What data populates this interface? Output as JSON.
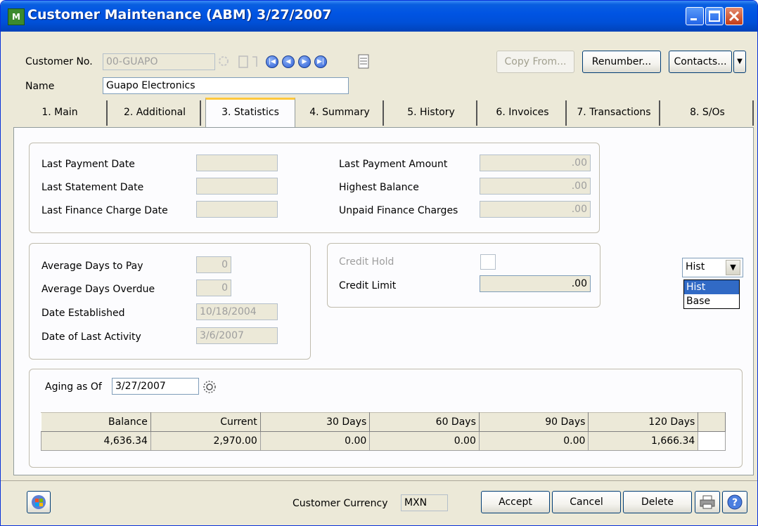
{
  "window": {
    "title": "Customer Maintenance (ABM) 3/27/2007",
    "icon": "app-icon"
  },
  "header": {
    "customer_no_label": "Customer No.",
    "customer_no": "00-GUAPO",
    "name_label": "Name",
    "name": "Guapo Electronics",
    "copy_from": "Copy From...",
    "renumber": "Renumber...",
    "contacts": "Contacts..."
  },
  "tabs": [
    {
      "label": "1. Main"
    },
    {
      "label": "2. Additional"
    },
    {
      "label": "3. Statistics"
    },
    {
      "label": "4. Summary"
    },
    {
      "label": "5. History"
    },
    {
      "label": "6. Invoices"
    },
    {
      "label": "7. Transactions"
    },
    {
      "label": "8. S/Os"
    }
  ],
  "payments": {
    "last_payment_date_label": "Last Payment Date",
    "last_statement_date_label": "Last Statement Date",
    "last_finance_charge_date_label": "Last Finance Charge Date",
    "last_payment_amount_label": "Last Payment Amount",
    "last_payment_amount": ".00",
    "highest_balance_label": "Highest Balance",
    "highest_balance": ".00",
    "unpaid_finance_label": "Unpaid Finance Charges",
    "unpaid_finance": ".00"
  },
  "days": {
    "avg_days_pay_label": "Average Days to Pay",
    "avg_days_pay": "0",
    "avg_days_overdue_label": "Average Days Overdue",
    "avg_days_overdue": "0",
    "date_established_label": "Date Established",
    "date_established": "10/18/2004",
    "last_activity_label": "Date of Last Activity",
    "last_activity": "3/6/2007"
  },
  "credit": {
    "credit_hold_label": "Credit Hold",
    "credit_limit_label": "Credit Limit",
    "credit_limit": ".00"
  },
  "hist_select": {
    "value": "Hist",
    "options": [
      "Hist",
      "Base"
    ]
  },
  "aging": {
    "label": "Aging as Of",
    "date": "3/27/2007",
    "headers": [
      "Balance",
      "Current",
      "30 Days",
      "60 Days",
      "90 Days",
      "120 Days"
    ],
    "values": [
      "4,636.34",
      "2,970.00",
      "0.00",
      "0.00",
      "0.00",
      "1,666.34"
    ]
  },
  "footer": {
    "currency_label": "Customer Currency",
    "currency": "MXN",
    "accept": "Accept",
    "cancel": "Cancel",
    "delete": "Delete"
  },
  "colors": {
    "titlebar": "#0054e3",
    "face": "#ece9d8",
    "selection": "#316ac5"
  }
}
